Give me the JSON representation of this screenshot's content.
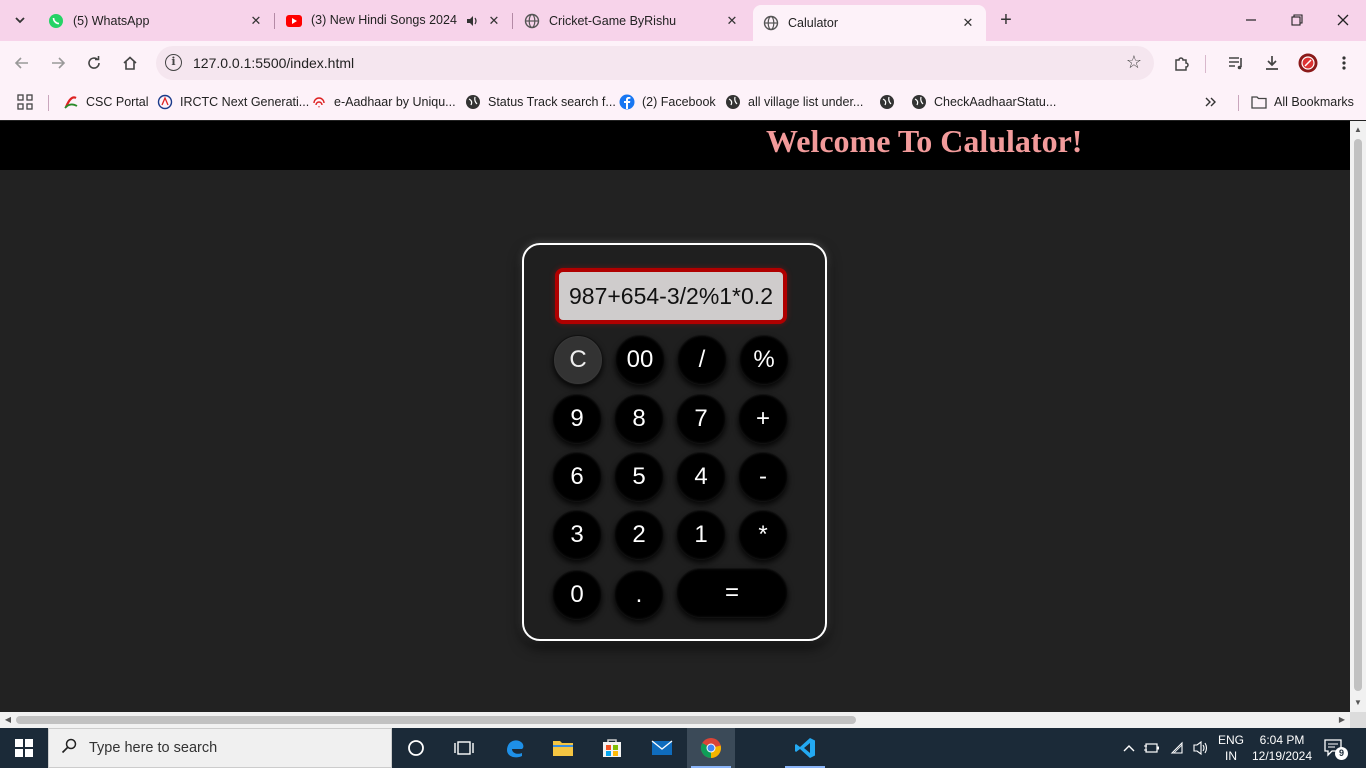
{
  "browser": {
    "tabs": [
      {
        "title": "(5) WhatsApp",
        "icon": "whatsapp-icon",
        "active": false
      },
      {
        "title": "(3) New Hindi Songs 2024 💡",
        "icon": "youtube-icon",
        "active": false,
        "audio": true
      },
      {
        "title": "Cricket-Game ByRishu",
        "icon": "globe-icon",
        "active": false
      },
      {
        "title": "Calulator",
        "icon": "globe-icon",
        "active": true
      }
    ],
    "url": "127.0.0.1:5500/index.html",
    "bookmarks": [
      {
        "label": "CSC Portal",
        "icon": "csc-icon"
      },
      {
        "label": "IRCTC Next Generati...",
        "icon": "irctc-icon"
      },
      {
        "label": "e-Aadhaar by Uniqu...",
        "icon": "fingerprint-icon"
      },
      {
        "label": "Status Track search f...",
        "icon": "globe-icon"
      },
      {
        "label": "(2) Facebook",
        "icon": "facebook-icon"
      },
      {
        "label": "all village list under...",
        "icon": "globe-icon"
      },
      {
        "label": "",
        "icon": "globe-icon"
      },
      {
        "label": "CheckAadhaarStatu...",
        "icon": "globe-icon"
      }
    ],
    "all_bookmarks_label": "All Bookmarks"
  },
  "page": {
    "heading": "Welcome To Calulator!",
    "display_value": "987+654-3/2%1*0.2",
    "keys": {
      "clear": "C",
      "double_zero": "00",
      "divide": "/",
      "percent": "%",
      "nine": "9",
      "eight": "8",
      "seven": "7",
      "plus": "+",
      "six": "6",
      "five": "5",
      "four": "4",
      "minus": "-",
      "three": "3",
      "two": "2",
      "one": "1",
      "multiply": "*",
      "zero": "0",
      "dot": ".",
      "equals": "="
    }
  },
  "taskbar": {
    "search_placeholder": "Type here to search",
    "language_line1": "ENG",
    "language_line2": "IN",
    "time": "6:04 PM",
    "date": "12/19/2024",
    "notification_count": "9"
  },
  "colors": {
    "tab_strip": "#f7d3ea",
    "toolbar": "#fdf2f9",
    "page_bg": "#222222",
    "header_bg": "#000000",
    "heading_color": "#f29b9b",
    "display_border": "#b00000",
    "taskbar": "#1b2a38"
  }
}
